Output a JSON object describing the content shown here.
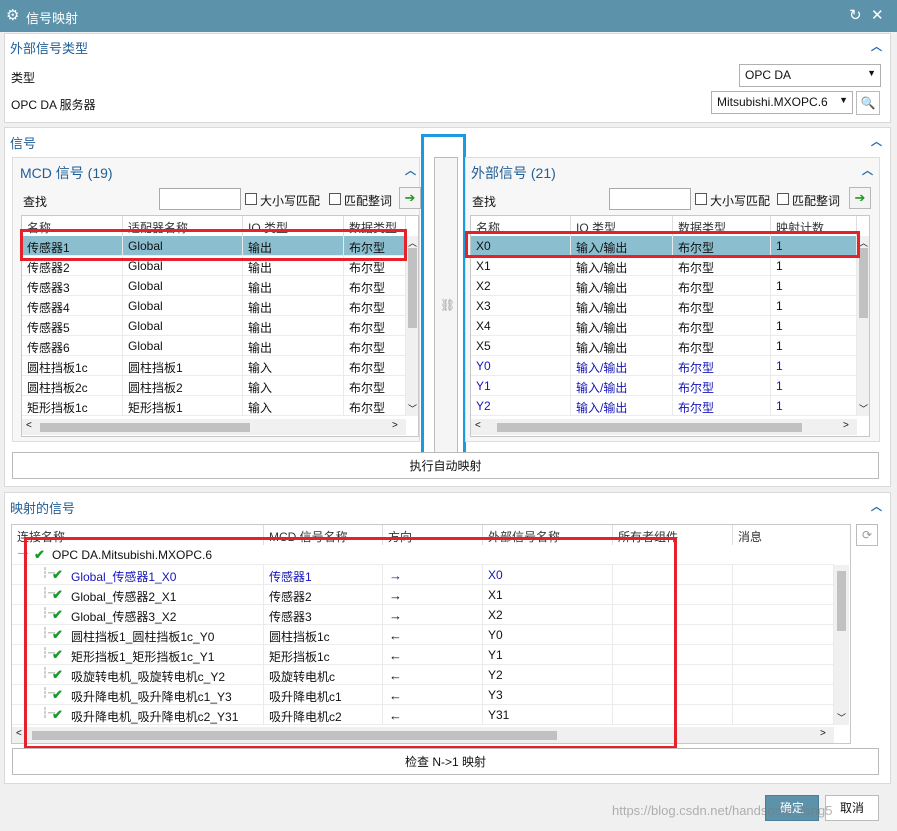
{
  "window": {
    "title": "信号映射"
  },
  "external_type": {
    "header": "外部信号类型",
    "type_label": "类型",
    "type_value": "OPC DA",
    "server_label": "OPC DA 服务器",
    "server_value": "Mitsubishi.MXOPC.6"
  },
  "signals": {
    "header": "信号"
  },
  "mcd": {
    "title": "MCD 信号 (19)",
    "search_label": "查找",
    "case_label": "大小写匹配",
    "word_label": "匹配整词",
    "columns": [
      "名称",
      "适配器名称",
      "IO 类型",
      "数据类型"
    ],
    "rows": [
      [
        "传感器1",
        "Global",
        "输出",
        "布尔型"
      ],
      [
        "传感器2",
        "Global",
        "输出",
        "布尔型"
      ],
      [
        "传感器3",
        "Global",
        "输出",
        "布尔型"
      ],
      [
        "传感器4",
        "Global",
        "输出",
        "布尔型"
      ],
      [
        "传感器5",
        "Global",
        "输出",
        "布尔型"
      ],
      [
        "传感器6",
        "Global",
        "输出",
        "布尔型"
      ],
      [
        "圆柱挡板1c",
        "圆柱挡板1",
        "输入",
        "布尔型"
      ],
      [
        "圆柱挡板2c",
        "圆柱挡板2",
        "输入",
        "布尔型"
      ],
      [
        "矩形挡板1c",
        "矩形挡板1",
        "输入",
        "布尔型"
      ]
    ]
  },
  "ext": {
    "title": "外部信号 (21)",
    "search_label": "查找",
    "case_label": "大小写匹配",
    "word_label": "匹配整词",
    "columns": [
      "名称",
      "IO 类型",
      "数据类型",
      "映射计数"
    ],
    "rows": [
      [
        "X0",
        "输入/输出",
        "布尔型",
        "1"
      ],
      [
        "X1",
        "输入/输出",
        "布尔型",
        "1"
      ],
      [
        "X2",
        "输入/输出",
        "布尔型",
        "1"
      ],
      [
        "X3",
        "输入/输出",
        "布尔型",
        "1"
      ],
      [
        "X4",
        "输入/输出",
        "布尔型",
        "1"
      ],
      [
        "X5",
        "输入/输出",
        "布尔型",
        "1"
      ],
      [
        "Y0",
        "输入/输出",
        "布尔型",
        "1"
      ],
      [
        "Y1",
        "输入/输出",
        "布尔型",
        "1"
      ],
      [
        "Y2",
        "输入/输出",
        "布尔型",
        "1"
      ]
    ]
  },
  "auto_map_label": "执行自动映射",
  "mapped": {
    "header": "映射的信号",
    "columns": [
      "连接名称",
      "MCD 信号名称",
      "方向",
      "外部信号名称",
      "所有者组件",
      "消息"
    ],
    "root": "OPC DA.Mitsubishi.MXOPC.6",
    "rows": [
      [
        "Global_传感器1_X0",
        "传感器1",
        "→",
        "X0"
      ],
      [
        "Global_传感器2_X1",
        "传感器2",
        "→",
        "X1"
      ],
      [
        "Global_传感器3_X2",
        "传感器3",
        "→",
        "X2"
      ],
      [
        "圆柱挡板1_圆柱挡板1c_Y0",
        "圆柱挡板1c",
        "←",
        "Y0"
      ],
      [
        "矩形挡板1_矩形挡板1c_Y1",
        "矩形挡板1c",
        "←",
        "Y1"
      ],
      [
        "吸旋转电机_吸旋转电机c_Y2",
        "吸旋转电机c",
        "←",
        "Y2"
      ],
      [
        "吸升降电机_吸升降电机c1_Y3",
        "吸升降电机c1",
        "←",
        "Y3"
      ],
      [
        "吸升降电机_吸升降电机c2_Y31",
        "吸升降电机c2",
        "←",
        "Y31"
      ]
    ]
  },
  "check_label": "检查 N->1 映射",
  "ok_label": "确定",
  "cancel_label": "取消",
  "watermark": "https://blog.csdn.net/handsome_fang5"
}
